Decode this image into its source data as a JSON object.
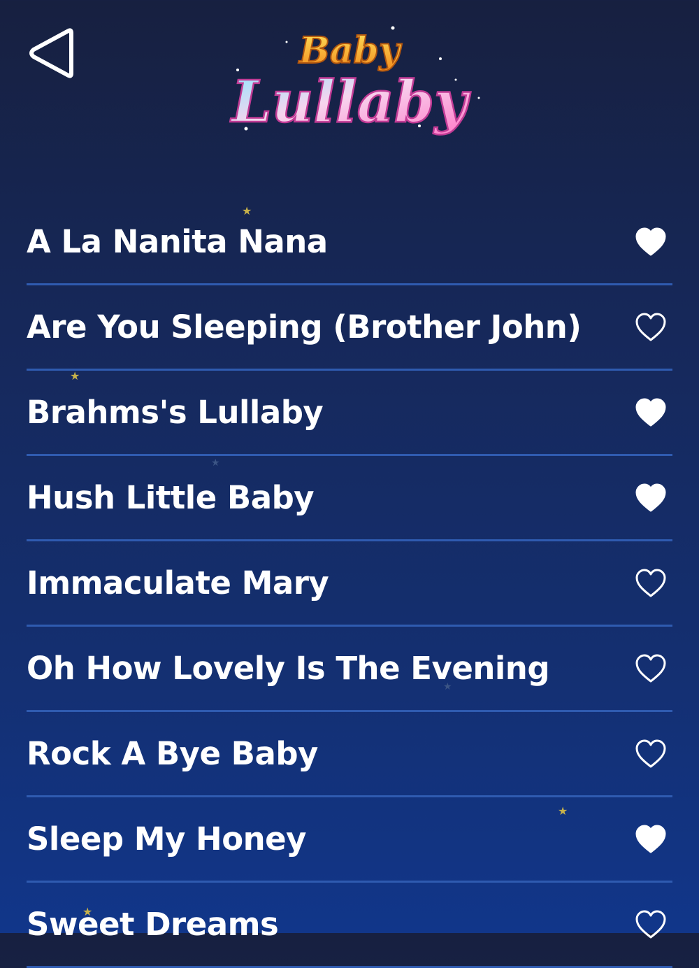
{
  "header": {
    "back_icon": "back-triangle-icon",
    "logo": {
      "line1": "Baby",
      "line2": "Lullaby"
    }
  },
  "songs": [
    {
      "title": "A La Nanita Nana",
      "favorite": true
    },
    {
      "title": "Are You Sleeping (Brother John)",
      "favorite": false
    },
    {
      "title": "Brahms's Lullaby",
      "favorite": true
    },
    {
      "title": "Hush Little Baby",
      "favorite": true
    },
    {
      "title": "Immaculate Mary",
      "favorite": false
    },
    {
      "title": "Oh How Lovely Is The Evening",
      "favorite": false
    },
    {
      "title": "Rock A Bye Baby",
      "favorite": false
    },
    {
      "title": "Sleep My Honey",
      "favorite": true
    },
    {
      "title": "Sweet Dreams",
      "favorite": false
    }
  ],
  "colors": {
    "background_top": "#172040",
    "background_bottom": "#11368a",
    "divider": "#2f5bb0",
    "text": "#ffffff"
  }
}
